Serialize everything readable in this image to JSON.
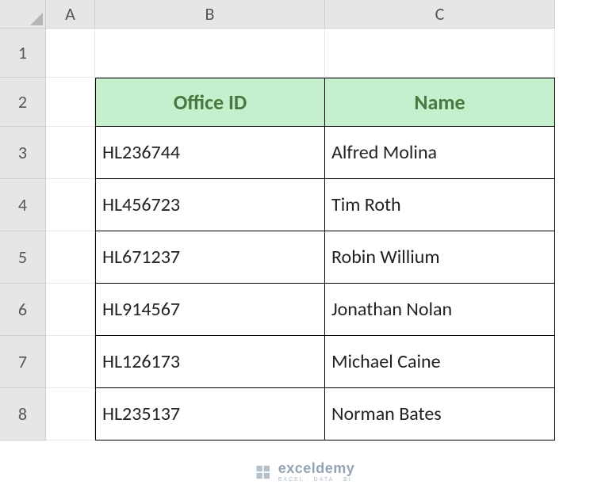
{
  "columns": {
    "A": "A",
    "B": "B",
    "C": "C"
  },
  "rows": [
    "1",
    "2",
    "3",
    "4",
    "5",
    "6",
    "7",
    "8"
  ],
  "headers": {
    "office_id": "Office ID",
    "name": "Name"
  },
  "data": [
    {
      "id": "HL236744",
      "name": "Alfred Molina"
    },
    {
      "id": "HL456723",
      "name": "Tim Roth"
    },
    {
      "id": "HL671237",
      "name": "Robin Willium"
    },
    {
      "id": "HL914567",
      "name": "Jonathan Nolan"
    },
    {
      "id": "HL126173",
      "name": "Michael Caine"
    },
    {
      "id": "HL235137",
      "name": "Norman Bates"
    }
  ],
  "watermark": {
    "main": "exceldemy",
    "sub": "EXCEL · DATA · BI"
  },
  "chart_data": {
    "type": "table",
    "title": "",
    "columns": [
      "Office ID",
      "Name"
    ],
    "rows": [
      [
        "HL236744",
        "Alfred Molina"
      ],
      [
        "HL456723",
        "Tim Roth"
      ],
      [
        "HL671237",
        "Robin Willium"
      ],
      [
        "HL914567",
        "Jonathan Nolan"
      ],
      [
        "HL126173",
        "Michael Caine"
      ],
      [
        "HL235137",
        "Norman Bates"
      ]
    ]
  }
}
